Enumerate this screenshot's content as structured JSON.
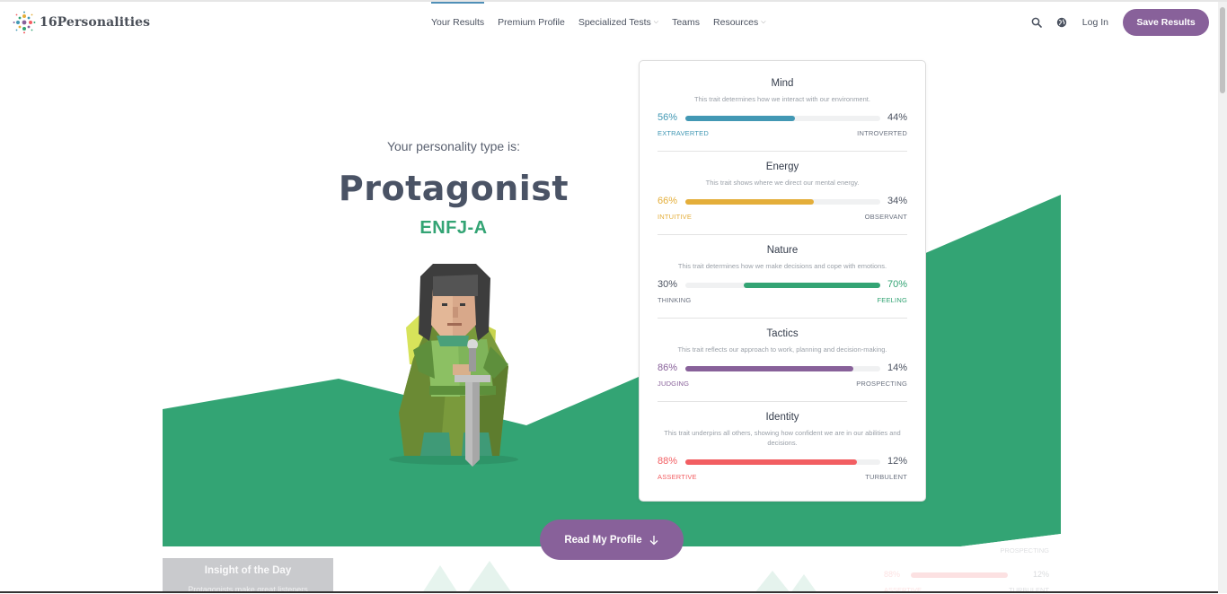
{
  "brand": {
    "name": "16Personalities",
    "accent": "#88619a",
    "green": "#33a474"
  },
  "nav": {
    "items": [
      {
        "label": "Your Results",
        "active": true,
        "dropdown": false
      },
      {
        "label": "Premium Profile",
        "active": false,
        "dropdown": false
      },
      {
        "label": "Specialized Tests",
        "active": false,
        "dropdown": true
      },
      {
        "label": "Teams",
        "active": false,
        "dropdown": false
      },
      {
        "label": "Resources",
        "active": false,
        "dropdown": true
      }
    ],
    "search_icon": "search-icon",
    "globe_icon": "globe-icon",
    "login_label": "Log In",
    "save_label": "Save Results"
  },
  "hero": {
    "intro": "Your personality type is:",
    "type_name": "Protagonist",
    "type_code": "ENFJ-A"
  },
  "traits": [
    {
      "title": "Mind",
      "description": "This trait determines how we interact with our environment.",
      "left_pct": "56%",
      "right_pct": "44%",
      "left_label": "EXTRAVERTED",
      "right_label": "INTROVERTED",
      "value": 0.56,
      "dominant": "left",
      "color": "#4298b4"
    },
    {
      "title": "Energy",
      "description": "This trait shows where we direct our mental energy.",
      "left_pct": "66%",
      "right_pct": "34%",
      "left_label": "INTUITIVE",
      "right_label": "OBSERVANT",
      "value": 0.66,
      "dominant": "left",
      "color": "#e4ae3a"
    },
    {
      "title": "Nature",
      "description": "This trait determines how we make decisions and cope with emotions.",
      "left_pct": "30%",
      "right_pct": "70%",
      "left_label": "THINKING",
      "right_label": "FEELING",
      "value": 0.7,
      "dominant": "right",
      "color": "#33a474"
    },
    {
      "title": "Tactics",
      "description": "This trait reflects our approach to work, planning and decision-making.",
      "left_pct": "86%",
      "right_pct": "14%",
      "left_label": "JUDGING",
      "right_label": "PROSPECTING",
      "value": 0.86,
      "dominant": "left",
      "color": "#88619a"
    },
    {
      "title": "Identity",
      "description": "This trait underpins all others, showing how confident we are in our abilities and decisions.",
      "left_pct": "88%",
      "right_pct": "12%",
      "left_label": "ASSERTIVE",
      "right_label": "TURBULENT",
      "value": 0.88,
      "dominant": "left",
      "color": "#f25e62"
    }
  ],
  "cta": {
    "read_label": "Read My Profile"
  },
  "below": {
    "insight_title": "Insight of the Day",
    "insight_sub": "Protagonists make great listeners",
    "ghost_prospecting": "PROSPECTING",
    "ghost_left_pct": "88%",
    "ghost_right_pct": "12%",
    "ghost_left_label": "ASSERTIVE",
    "ghost_right_label": "TURBULENT"
  }
}
